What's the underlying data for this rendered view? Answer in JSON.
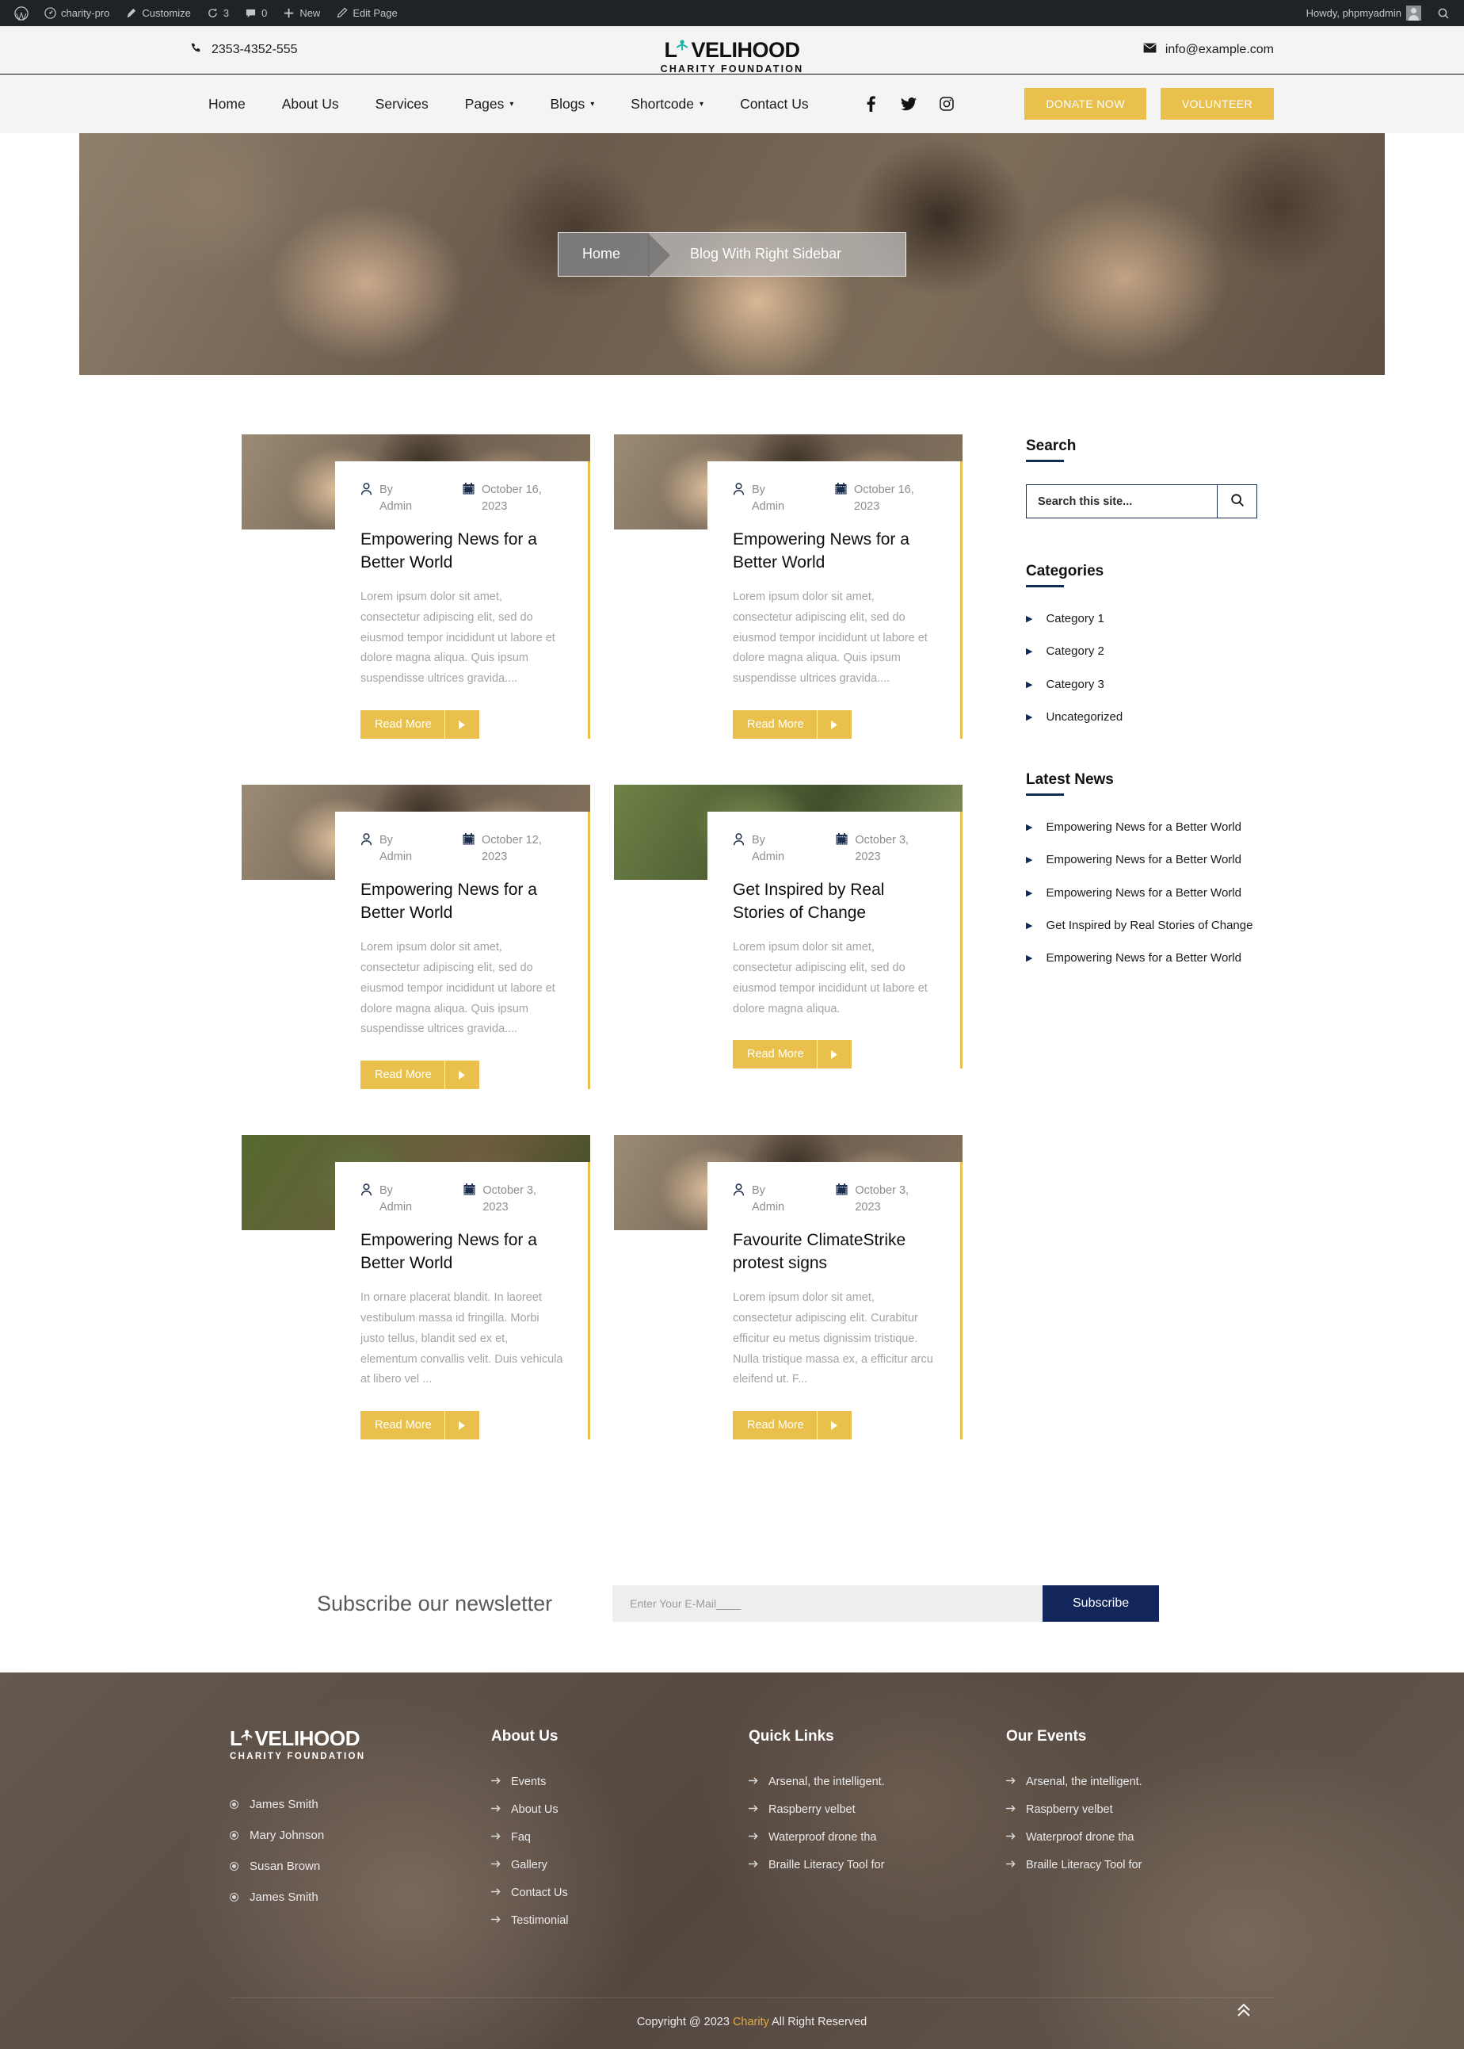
{
  "adminbar": {
    "site_name": "charity-pro",
    "customize": "Customize",
    "updates_count": "3",
    "comments_count": "0",
    "new": "New",
    "edit_page": "Edit Page",
    "howdy": "Howdy, phpmyadmin"
  },
  "topbar": {
    "phone": "2353-4352-555",
    "email": "info@example.com",
    "logo_main": "VELIHOOD",
    "logo_lead": "L",
    "logo_sub": "CHARITY FOUNDATION"
  },
  "nav": {
    "items": [
      {
        "label": "Home",
        "has_caret": false
      },
      {
        "label": "About Us",
        "has_caret": false
      },
      {
        "label": "Services",
        "has_caret": false
      },
      {
        "label": "Pages",
        "has_caret": true
      },
      {
        "label": "Blogs",
        "has_caret": true
      },
      {
        "label": "Shortcode",
        "has_caret": true
      },
      {
        "label": "Contact Us",
        "has_caret": false
      }
    ],
    "social": [
      "facebook-icon",
      "twitter-icon",
      "instagram-icon"
    ],
    "donate_label": "DONATE NOW",
    "volunteer_label": "VOLUNTEER"
  },
  "hero": {
    "breadcrumb_home": "Home",
    "breadcrumb_current": "Blog With Right Sidebar"
  },
  "posts": [
    {
      "by_label": "By Admin",
      "date": "October 16, 2023",
      "title": "Empowering News for a Better World",
      "excerpt": "Lorem ipsum dolor sit amet, consectetur adipiscing elit, sed do eiusmod tempor incididunt ut labore et dolore magna aliqua. Quis ipsum suspendisse ultrices gravida....",
      "read_more": "Read More"
    },
    {
      "by_label": "By Admin",
      "date": "October 16, 2023",
      "title": "Empowering News for a Better World",
      "excerpt": "Lorem ipsum dolor sit amet, consectetur adipiscing elit, sed do eiusmod tempor incididunt ut labore et dolore magna aliqua. Quis ipsum suspendisse ultrices gravida....",
      "read_more": "Read More"
    },
    {
      "by_label": "By Admin",
      "date": "October 12, 2023",
      "title": "Empowering News for a Better World",
      "excerpt": "Lorem ipsum dolor sit amet, consectetur adipiscing elit, sed do eiusmod tempor incididunt ut labore et dolore magna aliqua. Quis ipsum suspendisse ultrices gravida....",
      "read_more": "Read More"
    },
    {
      "by_label": "By Admin",
      "date": "October 3, 2023",
      "title": "Get Inspired by Real Stories of Change",
      "excerpt": "Lorem ipsum dolor sit amet, consectetur adipiscing elit, sed do eiusmod tempor incididunt ut labore et dolore magna aliqua.",
      "read_more": "Read More"
    },
    {
      "by_label": "By Admin",
      "date": "October 3, 2023",
      "title": "Empowering News for a Better World",
      "excerpt": "In ornare placerat blandit. In laoreet vestibulum massa id fringilla. Morbi justo tellus, blandit sed ex et, elementum convallis velit. Duis vehicula at libero vel ...",
      "read_more": "Read More"
    },
    {
      "by_label": "By Admin",
      "date": "October 3, 2023",
      "title": "Favourite ClimateStrike protest signs",
      "excerpt": "Lorem ipsum dolor sit amet, consectetur adipiscing elit. Curabitur efficitur eu metus dignissim tristique. Nulla tristique massa ex, a efficitur arcu eleifend ut. F...",
      "read_more": "Read More"
    }
  ],
  "sidebar": {
    "search_title": "Search",
    "search_placeholder": "Search this site...",
    "search_value": "",
    "categories_title": "Categories",
    "categories": [
      "Category 1",
      "Category 2",
      "Category 3",
      "Uncategorized"
    ],
    "latest_title": "Latest News",
    "latest": [
      "Empowering News for a Better World",
      "Empowering News for a Better World",
      "Empowering News for a Better World",
      "Get Inspired by Real Stories of Change",
      "Empowering News for a Better World"
    ]
  },
  "newsletter": {
    "title": "Subscribe our newsletter",
    "placeholder": "Enter Your E-Mail____",
    "value": "",
    "button": "Subscribe"
  },
  "footer": {
    "logo_lead": "L",
    "logo_main": "VELIHOOD",
    "logo_sub": "CHARITY FOUNDATION",
    "names": [
      "James Smith",
      "Mary Johnson",
      "Susan Brown",
      "James Smith"
    ],
    "about_title": "About Us",
    "about_links": [
      "Events",
      "About Us",
      "Faq",
      "Gallery",
      "Contact Us",
      "Testimonial"
    ],
    "quick_title": "Quick Links",
    "quick_links": [
      "Arsenal, the intelligent.",
      "Raspberry velbet",
      "Waterproof drone tha",
      "Braille Literacy Tool for"
    ],
    "events_title": "Our Events",
    "events_links": [
      "Arsenal, the intelligent.",
      "Raspberry velbet",
      "Waterproof drone tha",
      "Braille Literacy Tool for"
    ],
    "copyright_pre": "Copyright @ 2023 ",
    "copyright_brand": "Charity",
    "copyright_post": " All Right Reserved"
  },
  "colors": {
    "accent": "#e8c04b",
    "navy": "#13265c",
    "admin": "#1d2327"
  }
}
